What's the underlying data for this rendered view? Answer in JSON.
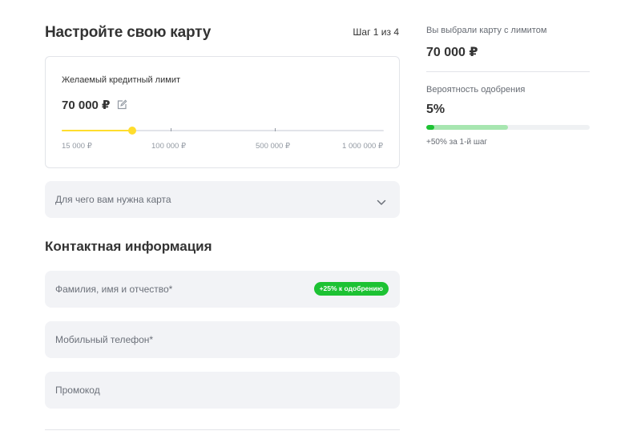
{
  "header": {
    "title": "Настройте свою карту",
    "step": "Шаг 1 из 4"
  },
  "limit_card": {
    "label": "Желаемый кредитный лимит",
    "amount": "70 000 ₽",
    "edit_icon": "pencil-edit-icon",
    "slider": {
      "value_fraction": 0.22,
      "tick_labels": [
        "15 000 ₽",
        "100 000 ₽",
        "500 000 ₽",
        "1 000 000 ₽"
      ],
      "accent_color": "#ffdd2d"
    }
  },
  "purpose_select": {
    "placeholder": "Для чего вам нужна карта",
    "icon": "chevron-down-icon"
  },
  "contact": {
    "title": "Контактная информация",
    "fields": [
      {
        "placeholder": "Фамилия, имя и отчество*",
        "badge": "+25% к одобрению"
      },
      {
        "placeholder": "Мобильный телефон*"
      },
      {
        "placeholder": "Промокод"
      }
    ]
  },
  "summary": {
    "chosen_label": "Вы выбрали карту с лимитом",
    "chosen_value": "70 000 ₽",
    "probability_label": "Вероятность одобрения",
    "probability_value": "5%",
    "probability_fraction": 0.05,
    "projected_fraction": 0.5,
    "note": "+50% за 1-й шаг",
    "accent_color": "#1dc233"
  }
}
